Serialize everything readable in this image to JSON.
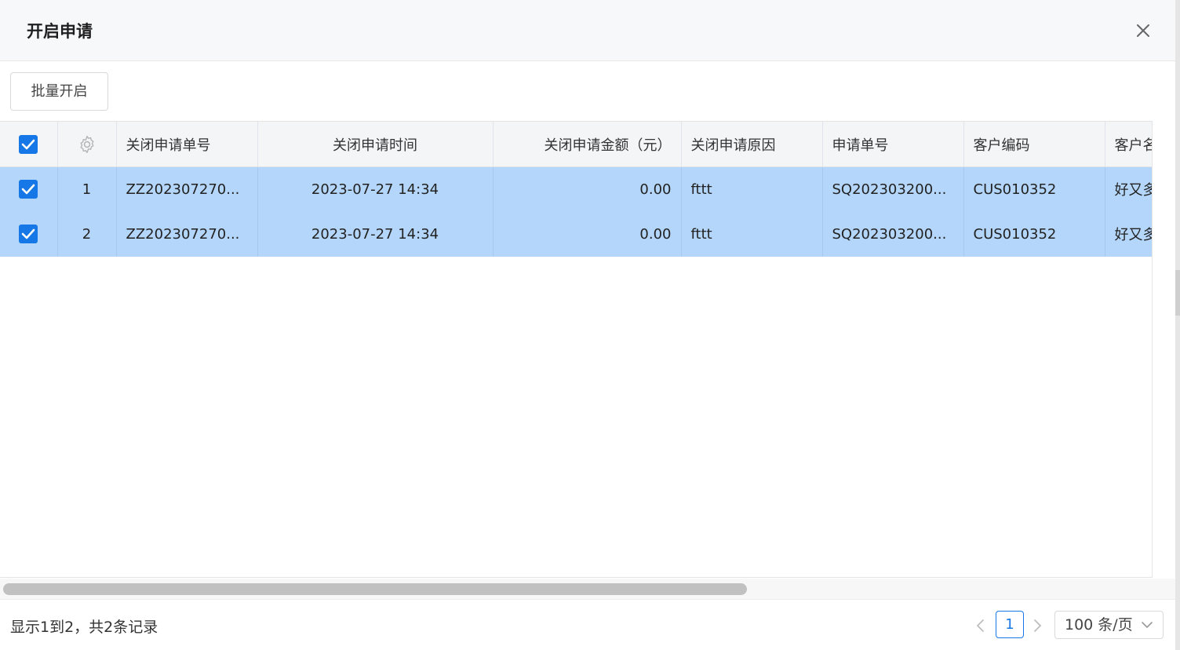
{
  "dialog": {
    "title": "开启申请"
  },
  "toolbar": {
    "batch_open_label": "批量开启"
  },
  "table": {
    "columns": [
      "关闭申请单号",
      "关闭申请时间",
      "关闭申请金额（元）",
      "关闭申请原因",
      "申请单号",
      "客户编码",
      "客户名称"
    ],
    "rows": [
      {
        "index": "1",
        "close_no": "ZZ202307270...",
        "close_time": "2023-07-27 14:34",
        "amount": "0.00",
        "reason": "fttt",
        "apply_no": "SQ202303200...",
        "customer_code": "CUS010352",
        "customer_name": "好又多"
      },
      {
        "index": "2",
        "close_no": "ZZ202307270...",
        "close_time": "2023-07-27 14:34",
        "amount": "0.00",
        "reason": "fttt",
        "apply_no": "SQ202303200...",
        "customer_code": "CUS010352",
        "customer_name": "好又多"
      }
    ]
  },
  "footer": {
    "summary": "显示1到2，共2条记录",
    "current_page": "1",
    "page_size": "100 条/页"
  },
  "colors": {
    "accent": "#1677e6",
    "selected_row": "#b4d6fa"
  }
}
